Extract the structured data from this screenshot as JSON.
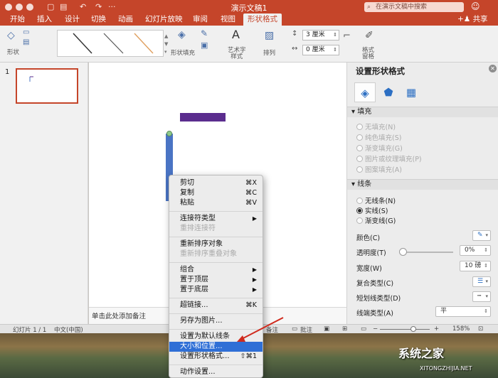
{
  "window": {
    "title": "演示文稿1",
    "search_placeholder": "在演示文稿中搜索",
    "share_label": "共享"
  },
  "tabs": [
    "开始",
    "插入",
    "设计",
    "切换",
    "动画",
    "幻灯片放映",
    "审阅",
    "视图",
    "形状格式"
  ],
  "active_tab": "形状格式",
  "ribbon": {
    "shape_label": "形状",
    "shape_fill_label": "形状填充",
    "wordart_label": "艺术字\n样式",
    "arrange_label": "排列",
    "height_value": "3 厘米",
    "width_value": "0 厘米",
    "format_pane_label": "格式\n窗格"
  },
  "slides": {
    "number": "1"
  },
  "canvas": {
    "notes_placeholder": "单击此处添加备注"
  },
  "context_menu": {
    "items": [
      {
        "label": "剪切",
        "shortcut": "⌘X"
      },
      {
        "label": "复制",
        "shortcut": "⌘C"
      },
      {
        "label": "粘贴",
        "shortcut": "⌘V"
      },
      {
        "label": "连接符类型",
        "submenu": "▶"
      },
      {
        "label": "重排连接符",
        "disabled": true
      },
      {
        "label": "重新排序对象"
      },
      {
        "label": "重新排序重叠对象",
        "disabled": true
      },
      {
        "label": "组合",
        "submenu": "▶"
      },
      {
        "label": "置于顶层",
        "submenu": "▶"
      },
      {
        "label": "置于底层",
        "submenu": "▶"
      },
      {
        "label": "超链接...",
        "shortcut": "⌘K"
      },
      {
        "label": "另存为图片..."
      },
      {
        "label": "设置为默认线条"
      },
      {
        "label": "大小和位置...",
        "highlighted": true
      },
      {
        "label": "设置形状格式...",
        "shortcut": "⇧⌘1"
      },
      {
        "label": "动作设置..."
      }
    ]
  },
  "format_pane": {
    "title": "设置形状格式",
    "fill_section": "填充",
    "fill_options": [
      "无填充(N)",
      "纯色填充(S)",
      "渐变填充(G)",
      "图片或纹理填充(P)",
      "图案填充(A)"
    ],
    "line_section": "线条",
    "line_options": [
      "无线条(N)",
      "实线(S)",
      "渐变线(G)"
    ],
    "line_selected": "实线(S)",
    "properties": {
      "color": "颜色(C)",
      "transparency": "透明度(T)",
      "transparency_value": "0%",
      "width": "宽度(W)",
      "width_value": "10 磅",
      "compound": "复合类型(C)",
      "dash": "短划线类型(D)",
      "cap": "线端类型(A)",
      "cap_value": "平"
    }
  },
  "status_bar": {
    "slide_info": "幻灯片 1 / 1",
    "language": "中文(中国)",
    "notes_label": "备注",
    "comments_label": "批注",
    "zoom": "158%"
  },
  "colors": {
    "accent": "#c5452a",
    "shape_horizontal": "#5b2d8e",
    "shape_vertical": "#4a74c4",
    "menu_highlight": "#2f6fd6"
  },
  "watermark": {
    "main": "系统之家",
    "sub": "XITONGZHIJIA.NET"
  }
}
